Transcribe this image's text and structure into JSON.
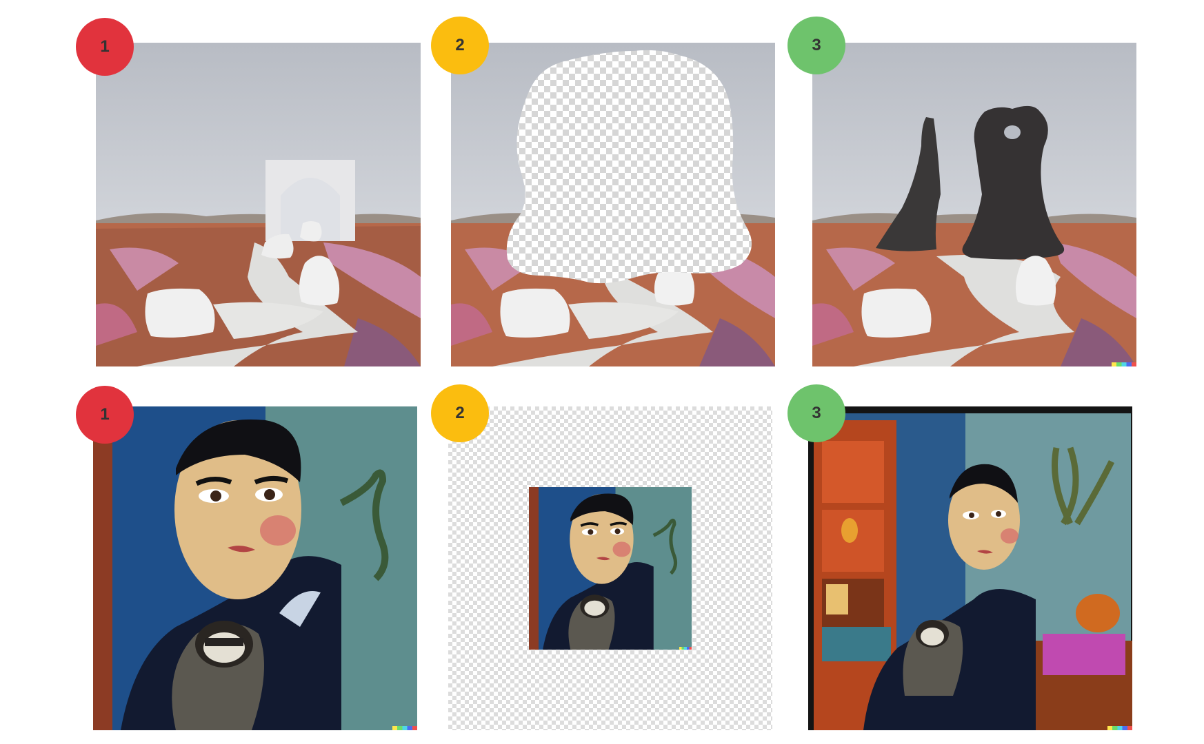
{
  "colors": {
    "step1": "#e1333d",
    "step2": "#fbbd0f",
    "step3": "#6ec36c",
    "text": "#333333"
  },
  "rows": [
    {
      "steps": [
        {
          "label": "1",
          "image": "desert-arch-landscape"
        },
        {
          "label": "2",
          "image": "desert-landscape-erased-region"
        },
        {
          "label": "3",
          "image": "desert-dark-rock-sculptures"
        }
      ]
    },
    {
      "steps": [
        {
          "label": "1",
          "image": "portrait-with-sloth"
        },
        {
          "label": "2",
          "image": "portrait-shrunk-on-transparent-canvas"
        },
        {
          "label": "3",
          "image": "portrait-outpainted-room"
        }
      ]
    }
  ]
}
